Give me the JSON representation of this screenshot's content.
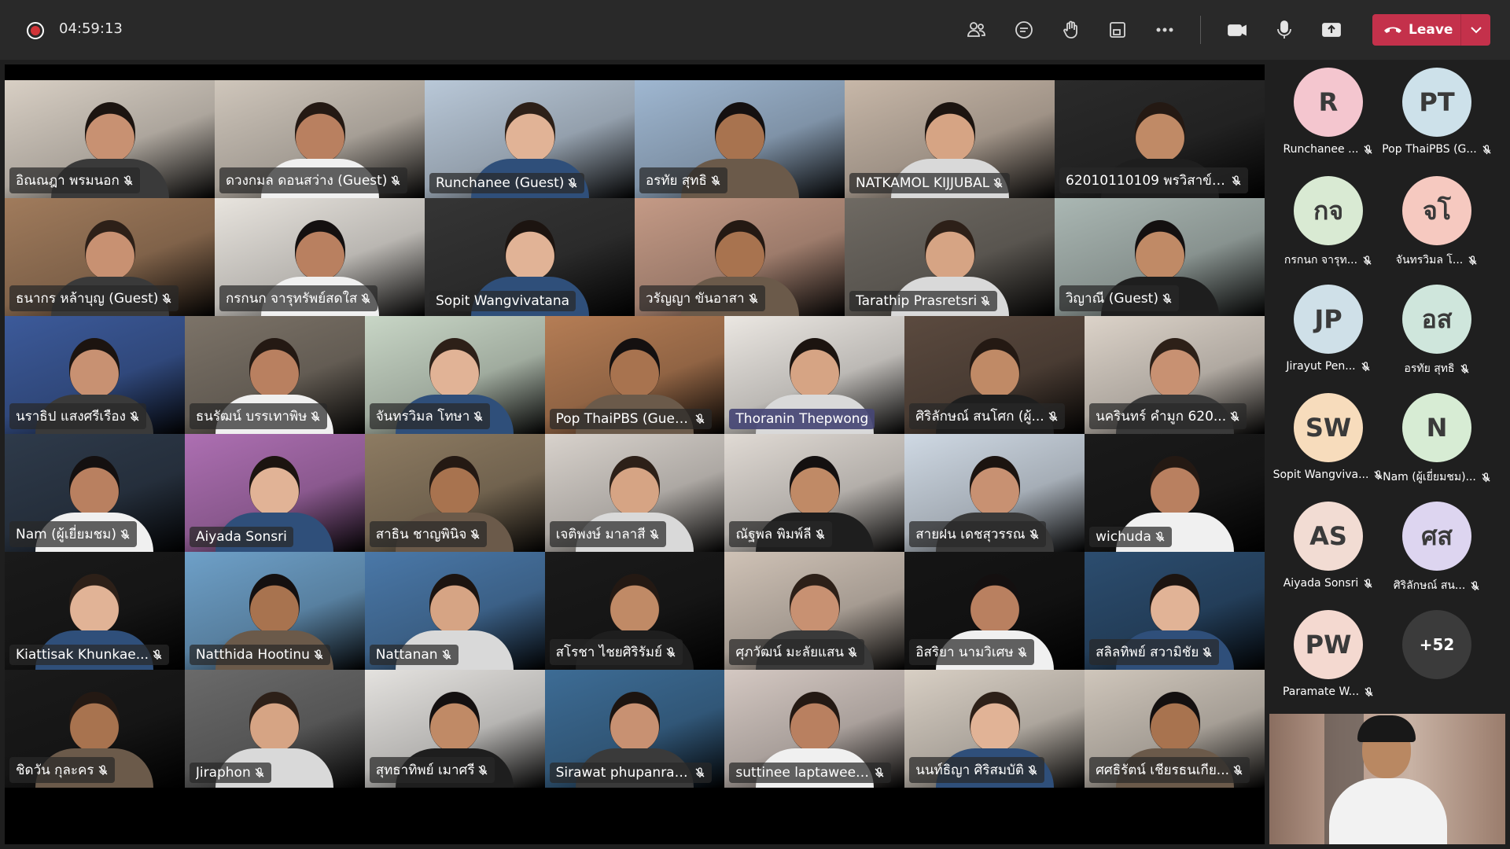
{
  "recording": {
    "elapsed": "04:59:13"
  },
  "toolbar": {
    "icons": [
      "people-icon",
      "chat-icon",
      "raise-hand-icon",
      "view-icon",
      "more-icon",
      "camera-icon",
      "mic-icon",
      "share-icon"
    ],
    "leave_label": "Leave"
  },
  "grid": {
    "rows": [
      [
        "อิณณฎา พรมนอก",
        "ดวงกมล ดอนสว่าง (Guest)",
        "Runchanee (Guest)",
        "อรทัย สุทธิ",
        "NATKAMOL KIJJUBAL",
        "62010110109 พรวิสาข์ ส..."
      ],
      [
        "ธนากร หล้าบุญ (Guest)",
        "กรกนก จารุทรัพย์สดใส",
        "Sopit Wangvivatana",
        "วรัญญา ขันอาสา",
        "Tarathip Prasretsri",
        "วิญาณี (Guest)"
      ],
      [
        "นราธิป แสงศรีเรือง",
        "ธนรัฒน์ บรรเทาพิษ",
        "จันทรวิมล โทษา",
        "Pop ThaiPBS (Guest)",
        "Thoranin Thepwong",
        "ศิริลักษณ์ สนโศก (ผู้...",
        "นครินทร์ คำมูก 620..."
      ],
      [
        "Nam (ผู้เยี่ยมชม)",
        "Aiyada Sonsri",
        "สาธิน ชาญพินิจ",
        "เจติพงษ์ มาลาสี",
        "ณัฐพล พิมพ์ลี",
        "สายฝน เดชสุวรรณ",
        "wichuda"
      ],
      [
        "Kiattisak Khunkae...",
        "Natthida Hootinu",
        "Nattanan",
        "สโรชา ไชยศิริรัมย์",
        "ศุภวัฒน์ มะลัยแสน",
        "อิสริยา นามวิเศษ",
        "สลิลทิพย์ สวามิชัย"
      ],
      [
        "ชิดวัน กุละคร",
        "Jiraphon",
        "สุทธาทิพย์ เมาศรี",
        "Sirawat phupanrat...",
        "suttinee laptawee (...",
        "นนท์ธิญา ศิริสมบัติ",
        "ศศธิรัตน์ เชียรธนเกีย..."
      ]
    ],
    "active_speaker": "Thoranin Thepwong"
  },
  "roster": [
    {
      "initials": "R",
      "name": "Runchanee ...",
      "color": "#f4c6cf"
    },
    {
      "initials": "PT",
      "name": "Pop ThaiPBS (G...",
      "color": "#cde1ea"
    },
    {
      "initials": "กจ",
      "name": "กรกนก จารุท...",
      "color": "#d9ead3"
    },
    {
      "initials": "จโ",
      "name": "จันทรวิมล โ...",
      "color": "#f6c9c0"
    },
    {
      "initials": "JP",
      "name": "Jirayut Pen...",
      "color": "#cfe0e8"
    },
    {
      "initials": "อส",
      "name": "อรทัย สุทธิ",
      "color": "#cfe6dc"
    },
    {
      "initials": "SW",
      "name": "Sopit Wangviva...",
      "color": "#f7dcbc"
    },
    {
      "initials": "N",
      "name": "Nam (ผู้เยี่ยมชม)...",
      "color": "#d7ecd4"
    },
    {
      "initials": "AS",
      "name": "Aiyada Sonsri",
      "color": "#f2dcd3"
    },
    {
      "initials": "ศส",
      "name": "ศิริลักษณ์ สน...",
      "color": "#ddd5f0"
    },
    {
      "initials": "PW",
      "name": "Paramate W...",
      "color": "#f4d9d0"
    },
    {
      "initials": "+52",
      "name": "",
      "color": "#3b3b3b"
    }
  ]
}
